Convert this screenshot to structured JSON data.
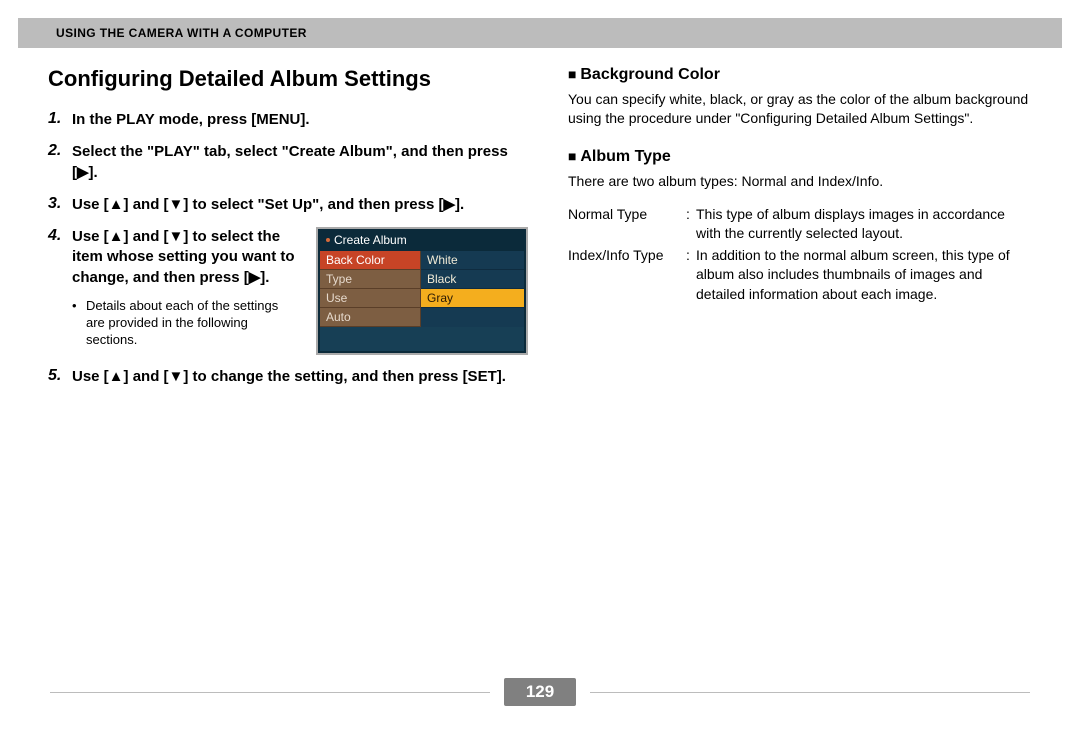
{
  "header": "USING THE CAMERA WITH A COMPUTER",
  "title": "Configuring Detailed Album Settings",
  "steps": {
    "s1": {
      "num": "1.",
      "text": "In the PLAY mode, press [MENU]."
    },
    "s2": {
      "num": "2.",
      "text": "Select the \"PLAY\" tab, select \"Create Album\", and then press [▶]."
    },
    "s3": {
      "num": "3.",
      "text": "Use [▲] and [▼] to select \"Set Up\", and then press [▶]."
    },
    "s4": {
      "num": "4.",
      "text": "Use [▲] and [▼] to select the item whose setting you want to change, and then press [▶].",
      "note": "Details about each of the settings are provided in the following sections."
    },
    "s5": {
      "num": "5.",
      "text": "Use [▲] and [▼] to change the setting, and then press [SET]."
    }
  },
  "menu": {
    "tab": "Create Album",
    "items": [
      "Back Color",
      "Type",
      "Use",
      "Auto"
    ],
    "item_selected": 0,
    "options": [
      "White",
      "Black",
      "Gray"
    ],
    "option_selected": 2
  },
  "right": {
    "bg_head": "Background Color",
    "bg_para": "You can specify white, black, or gray as the color of the album background using the procedure under \"Configuring Detailed Album Settings\".",
    "type_head": "Album Type",
    "type_intro": "There are two album types: Normal and Index/Info.",
    "defs": {
      "normal_term": "Normal Type",
      "normal_desc": "This type of album displays images in accordance with the currently selected layout.",
      "index_term": "Index/Info Type",
      "index_desc": "In addition to the normal album screen, this type of album also includes thumbnails of images and detailed information about each image."
    }
  },
  "page_number": "129"
}
